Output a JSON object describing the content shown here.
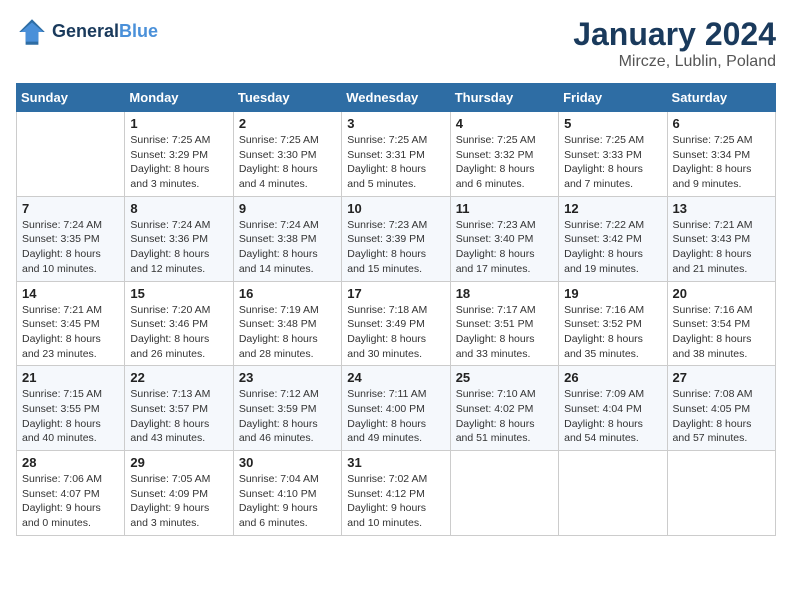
{
  "header": {
    "logo_line1": "General",
    "logo_line2": "Blue",
    "title": "January 2024",
    "subtitle": "Mircze, Lublin, Poland"
  },
  "weekdays": [
    "Sunday",
    "Monday",
    "Tuesday",
    "Wednesday",
    "Thursday",
    "Friday",
    "Saturday"
  ],
  "weeks": [
    [
      {
        "day": "",
        "info": ""
      },
      {
        "day": "1",
        "info": "Sunrise: 7:25 AM\nSunset: 3:29 PM\nDaylight: 8 hours\nand 3 minutes."
      },
      {
        "day": "2",
        "info": "Sunrise: 7:25 AM\nSunset: 3:30 PM\nDaylight: 8 hours\nand 4 minutes."
      },
      {
        "day": "3",
        "info": "Sunrise: 7:25 AM\nSunset: 3:31 PM\nDaylight: 8 hours\nand 5 minutes."
      },
      {
        "day": "4",
        "info": "Sunrise: 7:25 AM\nSunset: 3:32 PM\nDaylight: 8 hours\nand 6 minutes."
      },
      {
        "day": "5",
        "info": "Sunrise: 7:25 AM\nSunset: 3:33 PM\nDaylight: 8 hours\nand 7 minutes."
      },
      {
        "day": "6",
        "info": "Sunrise: 7:25 AM\nSunset: 3:34 PM\nDaylight: 8 hours\nand 9 minutes."
      }
    ],
    [
      {
        "day": "7",
        "info": "Sunrise: 7:24 AM\nSunset: 3:35 PM\nDaylight: 8 hours\nand 10 minutes."
      },
      {
        "day": "8",
        "info": "Sunrise: 7:24 AM\nSunset: 3:36 PM\nDaylight: 8 hours\nand 12 minutes."
      },
      {
        "day": "9",
        "info": "Sunrise: 7:24 AM\nSunset: 3:38 PM\nDaylight: 8 hours\nand 14 minutes."
      },
      {
        "day": "10",
        "info": "Sunrise: 7:23 AM\nSunset: 3:39 PM\nDaylight: 8 hours\nand 15 minutes."
      },
      {
        "day": "11",
        "info": "Sunrise: 7:23 AM\nSunset: 3:40 PM\nDaylight: 8 hours\nand 17 minutes."
      },
      {
        "day": "12",
        "info": "Sunrise: 7:22 AM\nSunset: 3:42 PM\nDaylight: 8 hours\nand 19 minutes."
      },
      {
        "day": "13",
        "info": "Sunrise: 7:21 AM\nSunset: 3:43 PM\nDaylight: 8 hours\nand 21 minutes."
      }
    ],
    [
      {
        "day": "14",
        "info": "Sunrise: 7:21 AM\nSunset: 3:45 PM\nDaylight: 8 hours\nand 23 minutes."
      },
      {
        "day": "15",
        "info": "Sunrise: 7:20 AM\nSunset: 3:46 PM\nDaylight: 8 hours\nand 26 minutes."
      },
      {
        "day": "16",
        "info": "Sunrise: 7:19 AM\nSunset: 3:48 PM\nDaylight: 8 hours\nand 28 minutes."
      },
      {
        "day": "17",
        "info": "Sunrise: 7:18 AM\nSunset: 3:49 PM\nDaylight: 8 hours\nand 30 minutes."
      },
      {
        "day": "18",
        "info": "Sunrise: 7:17 AM\nSunset: 3:51 PM\nDaylight: 8 hours\nand 33 minutes."
      },
      {
        "day": "19",
        "info": "Sunrise: 7:16 AM\nSunset: 3:52 PM\nDaylight: 8 hours\nand 35 minutes."
      },
      {
        "day": "20",
        "info": "Sunrise: 7:16 AM\nSunset: 3:54 PM\nDaylight: 8 hours\nand 38 minutes."
      }
    ],
    [
      {
        "day": "21",
        "info": "Sunrise: 7:15 AM\nSunset: 3:55 PM\nDaylight: 8 hours\nand 40 minutes."
      },
      {
        "day": "22",
        "info": "Sunrise: 7:13 AM\nSunset: 3:57 PM\nDaylight: 8 hours\nand 43 minutes."
      },
      {
        "day": "23",
        "info": "Sunrise: 7:12 AM\nSunset: 3:59 PM\nDaylight: 8 hours\nand 46 minutes."
      },
      {
        "day": "24",
        "info": "Sunrise: 7:11 AM\nSunset: 4:00 PM\nDaylight: 8 hours\nand 49 minutes."
      },
      {
        "day": "25",
        "info": "Sunrise: 7:10 AM\nSunset: 4:02 PM\nDaylight: 8 hours\nand 51 minutes."
      },
      {
        "day": "26",
        "info": "Sunrise: 7:09 AM\nSunset: 4:04 PM\nDaylight: 8 hours\nand 54 minutes."
      },
      {
        "day": "27",
        "info": "Sunrise: 7:08 AM\nSunset: 4:05 PM\nDaylight: 8 hours\nand 57 minutes."
      }
    ],
    [
      {
        "day": "28",
        "info": "Sunrise: 7:06 AM\nSunset: 4:07 PM\nDaylight: 9 hours\nand 0 minutes."
      },
      {
        "day": "29",
        "info": "Sunrise: 7:05 AM\nSunset: 4:09 PM\nDaylight: 9 hours\nand 3 minutes."
      },
      {
        "day": "30",
        "info": "Sunrise: 7:04 AM\nSunset: 4:10 PM\nDaylight: 9 hours\nand 6 minutes."
      },
      {
        "day": "31",
        "info": "Sunrise: 7:02 AM\nSunset: 4:12 PM\nDaylight: 9 hours\nand 10 minutes."
      },
      {
        "day": "",
        "info": ""
      },
      {
        "day": "",
        "info": ""
      },
      {
        "day": "",
        "info": ""
      }
    ]
  ]
}
